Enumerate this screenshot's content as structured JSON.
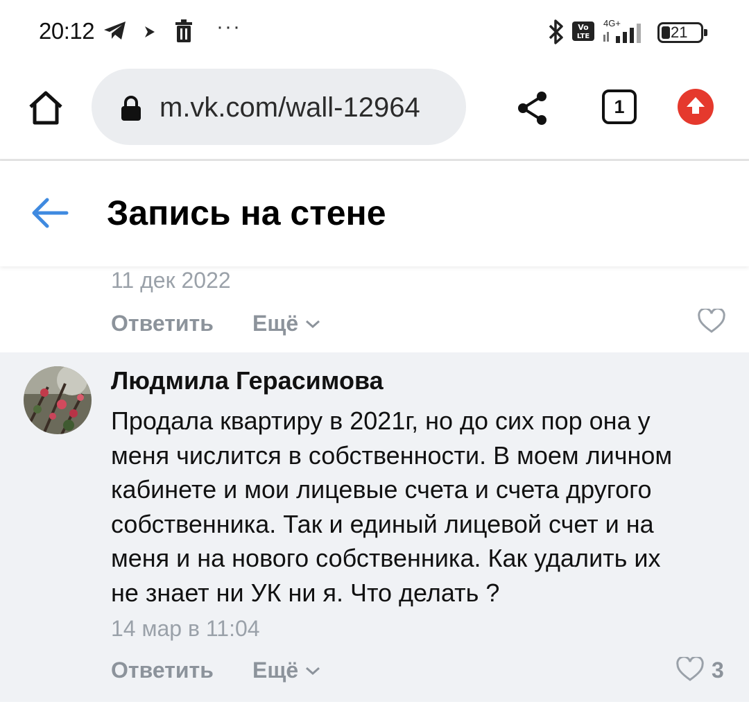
{
  "status_bar": {
    "time": "20:12",
    "more": "···",
    "network": "4G+",
    "battery": "21",
    "icons": [
      "telegram-icon",
      "play-icon",
      "trash-icon",
      "bluetooth-icon",
      "volte-icon",
      "signal-icon",
      "battery-icon"
    ]
  },
  "browser": {
    "url": "m.vk.com/wall-12964",
    "tab_count": "1",
    "colors": {
      "url_bar_bg": "#ebedf0",
      "update_badge": "#e5392d"
    }
  },
  "header": {
    "title": "Запись на стене"
  },
  "comments": [
    {
      "date": "11 дек 2022",
      "reply_label": "Ответить",
      "more_label": "Ещё",
      "likes": ""
    },
    {
      "author": "Людмила Герасимова",
      "lines": [
        "Продала квартиру в 2021г, но до сих пор она у",
        "меня числится в собственности. В моем личном",
        "кабинете и мои лицевые счета и счета другого",
        "собственника. Так и единый лицевой счет и на",
        "меня и на нового собственника. Как удалить их",
        "не знает ни УК ни я. Что делать ?"
      ],
      "date": "14 мар в 11:04",
      "reply_label": "Ответить",
      "more_label": "Ещё",
      "likes": "3"
    }
  ],
  "colors": {
    "accent": "#3f8ae0",
    "secondary_text": "#8c939b",
    "comment_bg": "#f0f2f5"
  }
}
